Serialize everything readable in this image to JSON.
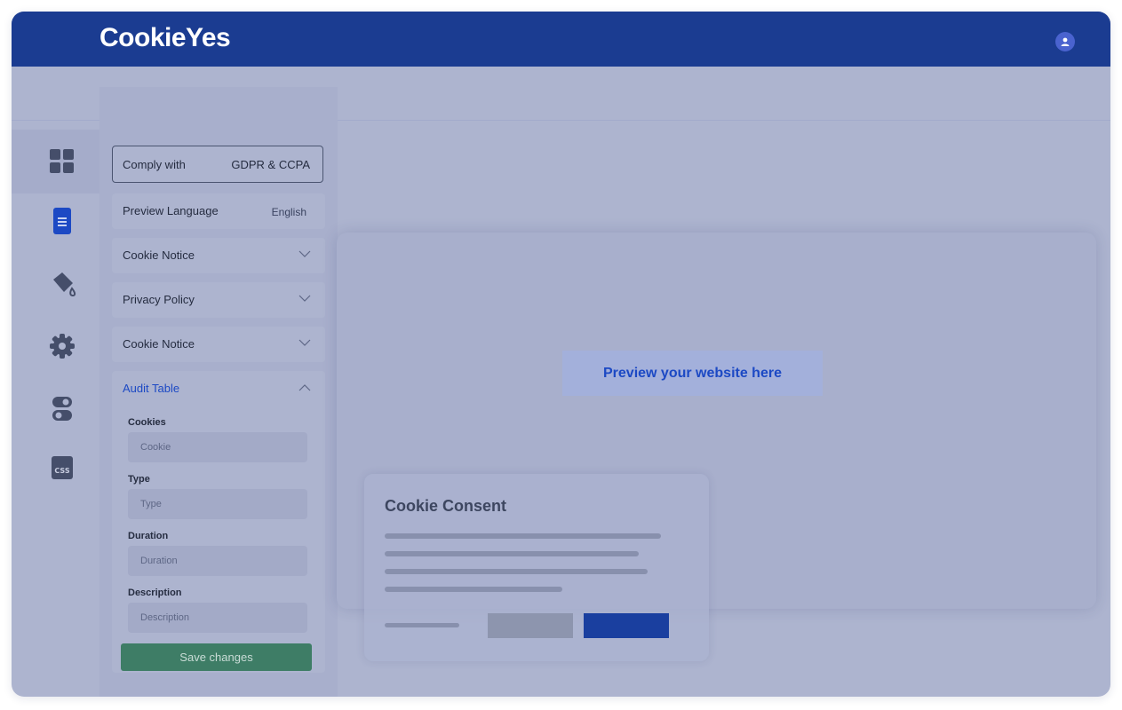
{
  "header": {
    "logo_text": "CookieYes",
    "avatar_icon": "user-icon"
  },
  "sidebar": {
    "icons": [
      {
        "name": "dashboard-icon",
        "active": true
      },
      {
        "name": "document-icon",
        "active": false
      },
      {
        "name": "paint-bucket-icon",
        "active": false
      },
      {
        "name": "gear-icon",
        "active": false
      },
      {
        "name": "toggle-icon",
        "active": false
      },
      {
        "name": "css-file-icon",
        "active": false
      }
    ]
  },
  "panel": {
    "comply_label": "Comply with",
    "comply_value": "GDPR & CCPA",
    "preview_language_label": "Preview Language",
    "preview_language_value": "English",
    "sections": [
      {
        "label": "Cookie Notice"
      },
      {
        "label": "Privacy Policy"
      },
      {
        "label": "Cookie Notice"
      }
    ],
    "audit": {
      "title": "Audit Table",
      "fields": [
        {
          "label": "Cookies",
          "placeholder": "Cookie"
        },
        {
          "label": "Type",
          "placeholder": "Type"
        },
        {
          "label": "Duration",
          "placeholder": "Duration"
        },
        {
          "label": "Description",
          "placeholder": "Description"
        }
      ],
      "save_label": "Save changes"
    }
  },
  "preview": {
    "label": "Preview your website here"
  },
  "consent": {
    "title": "Cookie Consent"
  },
  "colors": {
    "header": "#1b3c91",
    "accent": "#1c49c4",
    "save_button": "#3e7d66",
    "accept_button": "#1a3f9f",
    "overlay": "#adb4cf"
  }
}
